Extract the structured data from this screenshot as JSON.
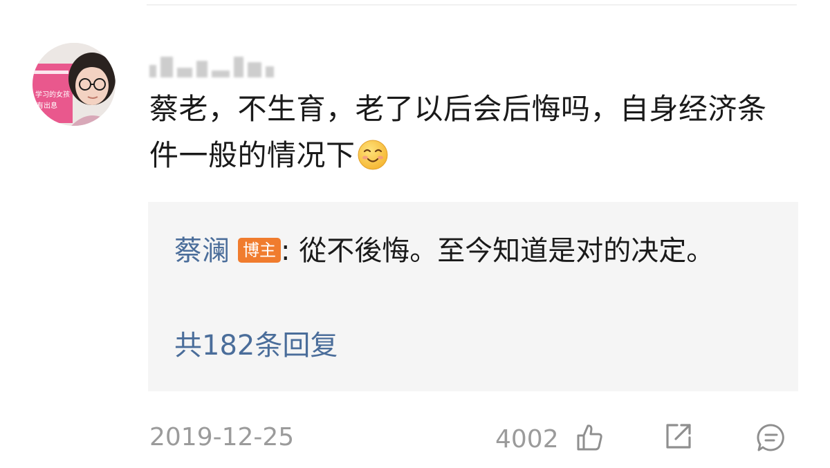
{
  "comment": {
    "author_avatar": "user-avatar",
    "avatar_book_text": "学习的女孩 有出息",
    "text": "蔡老，不生育，老了以后会后悔吗，自身经济条件一般的情况下",
    "emoji": "smile-icon"
  },
  "reply": {
    "author": "蔡澜",
    "badge": "博主",
    "separator": ":",
    "text": " 從不後悔。至今知道是对的决定。",
    "count_label": "共182条回复"
  },
  "footer": {
    "date": "2019-12-25",
    "likes": "4002",
    "icons": [
      "thumbs-up-icon",
      "share-icon",
      "comment-icon"
    ]
  },
  "colors": {
    "link_blue": "#4a6d9a",
    "badge_orange": "#f07c2e",
    "muted_gray": "#9b9b9b",
    "reply_bg": "#f5f5f5"
  }
}
